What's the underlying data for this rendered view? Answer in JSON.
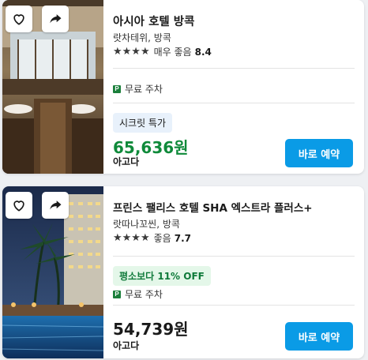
{
  "hotels": [
    {
      "name": "아시아 호텔 방콕",
      "location": "랏차테위, 방콕",
      "stars": "★★★★",
      "rating_text": "매우 좋음",
      "rating_score": "8.4",
      "amenity": "무료 주차",
      "badge": "시크릿 특가",
      "price": "65,636원",
      "provider": "아고다",
      "book_label": "바로 예약"
    },
    {
      "name": "프린스 팰리스 호텔 SHA 엑스트라 플러스+",
      "location": "랏따나꼬씬, 방콕",
      "stars": "★★★★",
      "rating_text": "좋음",
      "rating_score": "7.7",
      "amenity": "무료 주차",
      "badge": "평소보다 11% OFF",
      "price": "54,739원",
      "provider": "아고다",
      "book_label": "바로 예약"
    }
  ],
  "icons": {
    "favorite": "heart-icon",
    "share": "share-icon",
    "parking": "parking-icon"
  },
  "colors": {
    "book_button": "#0a9be6",
    "discount_green": "#0f8a3a",
    "secret_badge_bg": "#e8f1fb",
    "off_badge_bg": "#e4f7e9",
    "parking_icon": "#1b7f3b"
  }
}
